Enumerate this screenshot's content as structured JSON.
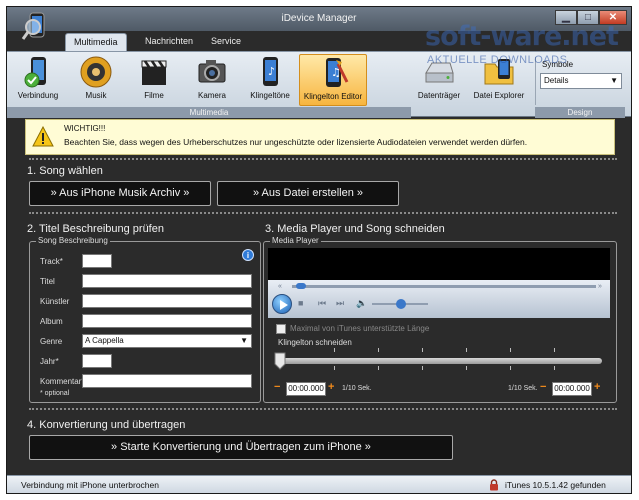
{
  "window": {
    "title": "iDevice Manager",
    "min_glyph": "▁",
    "max_glyph": "□",
    "close_glyph": "✕"
  },
  "tabs": [
    {
      "label": "Multimedia",
      "active": true
    },
    {
      "label": "Nachrichten",
      "active": false
    },
    {
      "label": "Service",
      "active": false
    }
  ],
  "ribbon": {
    "items": [
      {
        "label": "Verbindung",
        "icon": "phone-connect-icon"
      },
      {
        "label": "Musik",
        "icon": "speaker-icon"
      },
      {
        "label": "Filme",
        "icon": "clapperboard-icon"
      },
      {
        "label": "Kamera",
        "icon": "camera-icon"
      },
      {
        "label": "Klingeltöne",
        "icon": "ringtone-phone-icon"
      },
      {
        "label": "Klingelton Editor",
        "icon": "ringtone-editor-icon",
        "selected": true
      },
      {
        "label": "Datenträger",
        "icon": "drive-icon"
      },
      {
        "label": "Datei Explorer",
        "icon": "file-explorer-icon"
      }
    ],
    "group_multimedia": "Multimedia",
    "group_design": "Design",
    "symbole_label": "Symbole",
    "view_select_value": "Details"
  },
  "watermark": {
    "text": "soft-ware.net",
    "sub": "AKTUELLE DOWNLOADS"
  },
  "warning": {
    "title": "WICHTIG!!!",
    "text": "Beachten Sie, dass wegen des Urheberschutzes nur ungeschützte oder lizensierte Audiodateien verwendet werden dürfen."
  },
  "section1": {
    "title": "1. Song wählen",
    "btn_archive": "» Aus iPhone Musik Archiv »",
    "btn_file": "» Aus Datei erstellen »"
  },
  "section2": {
    "title": "2. Titel Beschreibung prüfen",
    "legend": "Song Beschreibung",
    "fields": {
      "track": "Track*",
      "titel": "Titel",
      "kuenstler": "Künstler",
      "album": "Album",
      "genre": "Genre",
      "jahr": "Jahr*",
      "kommentar": "Kommentar*"
    },
    "genre_value": "A Cappella",
    "optional_note": "* optional"
  },
  "section3": {
    "title": "3. Media Player und Song schneiden",
    "legend": "Media Player",
    "max_label": "Maximal von iTunes unterstützte Länge",
    "cut_label": "Klingelton schneiden",
    "time_start": "00:00.000",
    "time_end": "00:00.000",
    "unit_left": "1/10 Sek.",
    "unit_right": "1/10 Sek."
  },
  "section4": {
    "title": "4. Konvertierung und übertragen",
    "btn_convert": "» Starte Konvertierung und Übertragen zum iPhone »"
  },
  "status": {
    "left": "Verbindung mit iPhone unterbrochen",
    "right": "iTunes 10.5.1.42 gefunden"
  }
}
